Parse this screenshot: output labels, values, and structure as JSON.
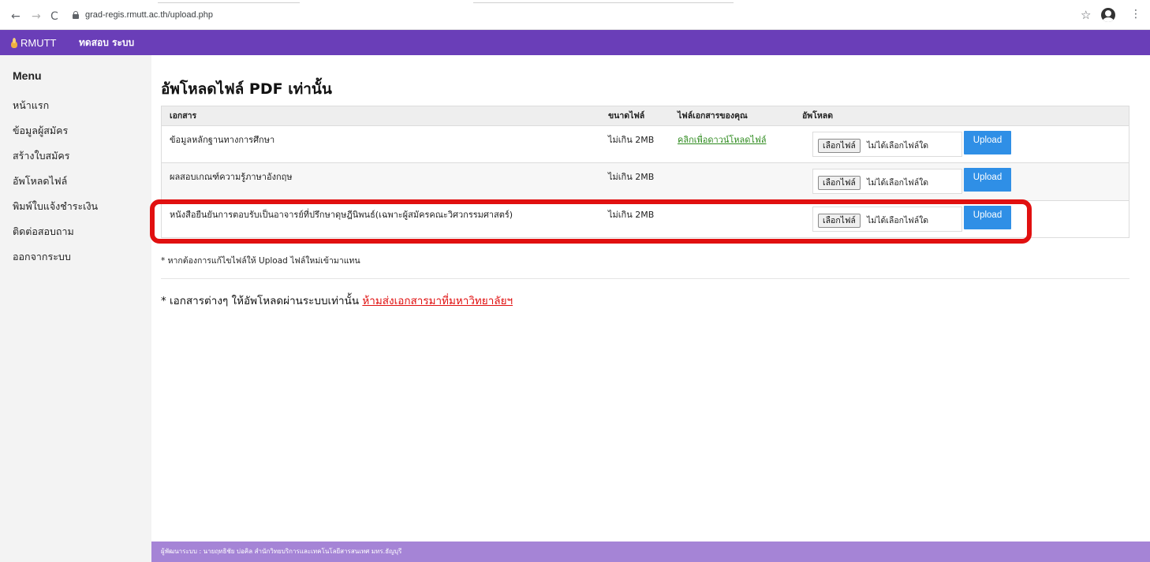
{
  "browser": {
    "url": "grad-regis.rmutt.ac.th/upload.php",
    "back_icon": "←",
    "forward_icon": "→",
    "reload_icon": "C",
    "star_icon": "☆",
    "menu_icon": "⋮"
  },
  "topbar": {
    "brand": "RMUTT",
    "menu_item": "ทดสอบ ระบบ",
    "color": "#6a3eb8"
  },
  "sidebar": {
    "title": "Menu",
    "items": [
      {
        "label": "หน้าแรก"
      },
      {
        "label": "ข้อมูลผู้สมัคร"
      },
      {
        "label": "สร้างใบสมัคร"
      },
      {
        "label": "อัพโหลดไฟล์"
      },
      {
        "label": "พิมพ์ใบแจ้งชำระเงิน"
      },
      {
        "label": "ติดต่อสอบถาม"
      },
      {
        "label": "ออกจากระบบ"
      }
    ]
  },
  "main": {
    "title": "อัพโหลดไฟล์ PDF เท่านั้น",
    "table": {
      "headers": {
        "document": "เอกสาร",
        "file_size": "ขนาดไฟล์",
        "your_file": "ไฟล์เอกสารของคุณ",
        "upload": "อัพโหลด"
      },
      "rows": [
        {
          "document": "ข้อมูลหลักฐานทางการศึกษา",
          "size": "ไม่เกิน 2MB",
          "file_link": "คลิกเพื่อดาวน์โหลดไฟล์",
          "choose_file": "เลือกไฟล์",
          "no_file": "ไม่ได้เลือกไฟล์ใด",
          "upload_label": "Upload"
        },
        {
          "document": "ผลสอบเกณฑ์ความรู้ภาษาอังกฤษ",
          "size": "ไม่เกิน 2MB",
          "file_link": "",
          "choose_file": "เลือกไฟล์",
          "no_file": "ไม่ได้เลือกไฟล์ใด",
          "upload_label": "Upload"
        },
        {
          "document": "หนังสือยืนยันการตอบรับเป็นอาจารย์ที่ปรึกษาดุษฎีนิพนธ์(เฉพาะผู้สมัครคณะวิศวกรรมศาสตร์)",
          "size": "ไม่เกิน 2MB",
          "file_link": "",
          "choose_file": "เลือกไฟล์",
          "no_file": "ไม่ได้เลือกไฟล์ใด",
          "upload_label": "Upload"
        }
      ]
    },
    "note": "* หากต้องการแก้ไขไฟล์ให้ Upload ไฟล์ใหม่เข้ามาแทน",
    "notice_prefix": "* เอกสารต่างๆ ให้อัพโหลดผ่านระบบเท่านั้น ",
    "notice_link": "ห้ามส่งเอกสารมาที่มหาวิทยาลัยฯ"
  },
  "footer": {
    "text": "ผู้พัฒนาระบบ : นายฤทธิชัย บ่อคิล สำนักวิทยบริการและเทคโนโลยีสารสนเทศ มทร.ธัญบุรี"
  },
  "colors": {
    "upload_button": "#2f8fe6",
    "footer": "#a584d6",
    "highlight": "#e11010",
    "link_green": "#2e8b1e",
    "warning_red": "#e01010"
  }
}
